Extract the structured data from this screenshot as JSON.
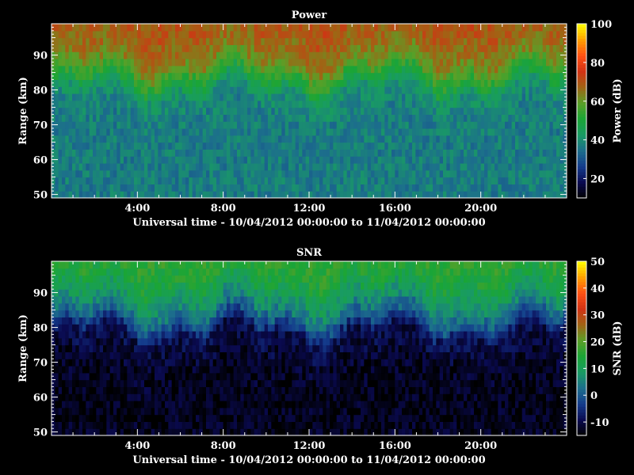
{
  "chart_data": [
    {
      "type": "heatmap",
      "title": "Power",
      "xlabel": "Universal time - 10/04/2012 00:00:00 to 11/04/2012 00:00:00",
      "ylabel": "Range (km)",
      "xlim": [
        0,
        24
      ],
      "ylim": [
        49,
        99
      ],
      "x_ticks": [
        {
          "v": 4,
          "label": "4:00"
        },
        {
          "v": 8,
          "label": "8:00"
        },
        {
          "v": 12,
          "label": "12:00"
        },
        {
          "v": 16,
          "label": "16:00"
        },
        {
          "v": 20,
          "label": "20:00"
        }
      ],
      "y_ticks": [
        {
          "v": 50,
          "label": "50"
        },
        {
          "v": 60,
          "label": "60"
        },
        {
          "v": 70,
          "label": "70"
        },
        {
          "v": 80,
          "label": "80"
        },
        {
          "v": 90,
          "label": "90"
        }
      ],
      "colorbar": {
        "label": "Power (dB)",
        "range": [
          10,
          100
        ],
        "ticks": [
          {
            "v": 20,
            "label": "20"
          },
          {
            "v": 40,
            "label": "40"
          },
          {
            "v": 60,
            "label": "60"
          },
          {
            "v": 80,
            "label": "80"
          },
          {
            "v": 100,
            "label": "100"
          }
        ]
      },
      "profile_km": [
        50,
        55,
        60,
        65,
        70,
        75,
        80,
        82,
        85,
        88,
        92,
        96,
        99
      ],
      "profile_value": [
        37,
        37,
        37,
        37,
        37,
        38,
        42,
        48,
        55,
        62,
        66,
        68,
        70
      ]
    },
    {
      "type": "heatmap",
      "title": "SNR",
      "xlabel": "Universal time - 10/04/2012 00:00:00 to 11/04/2012 00:00:00",
      "ylabel": "Range (km)",
      "xlim": [
        0,
        24
      ],
      "ylim": [
        49,
        99
      ],
      "x_ticks": [
        {
          "v": 4,
          "label": "4:00"
        },
        {
          "v": 8,
          "label": "8:00"
        },
        {
          "v": 12,
          "label": "12:00"
        },
        {
          "v": 16,
          "label": "16:00"
        },
        {
          "v": 20,
          "label": "20:00"
        }
      ],
      "y_ticks": [
        {
          "v": 50,
          "label": "50"
        },
        {
          "v": 60,
          "label": "60"
        },
        {
          "v": 70,
          "label": "70"
        },
        {
          "v": 80,
          "label": "80"
        },
        {
          "v": 90,
          "label": "90"
        }
      ],
      "colorbar": {
        "label": "SNR (dB)",
        "range": [
          -15,
          50
        ],
        "ticks": [
          {
            "v": -10,
            "label": "-10"
          },
          {
            "v": 0,
            "label": "0"
          },
          {
            "v": 10,
            "label": "10"
          },
          {
            "v": 20,
            "label": "20"
          },
          {
            "v": 30,
            "label": "30"
          },
          {
            "v": 40,
            "label": "40"
          },
          {
            "v": 50,
            "label": "50"
          }
        ]
      },
      "profile_km": [
        50,
        60,
        70,
        78,
        82,
        86,
        90,
        94,
        99
      ],
      "profile_value": [
        -13,
        -13,
        -12,
        -9,
        0,
        6,
        10,
        14,
        16
      ]
    }
  ],
  "colormap": [
    "#000000",
    "#0a0a50",
    "#143c8c",
    "#1c6e8c",
    "#199b64",
    "#1aa536",
    "#5aa028",
    "#a06414",
    "#d23214",
    "#ff5014",
    "#ffa000",
    "#ffff00"
  ]
}
